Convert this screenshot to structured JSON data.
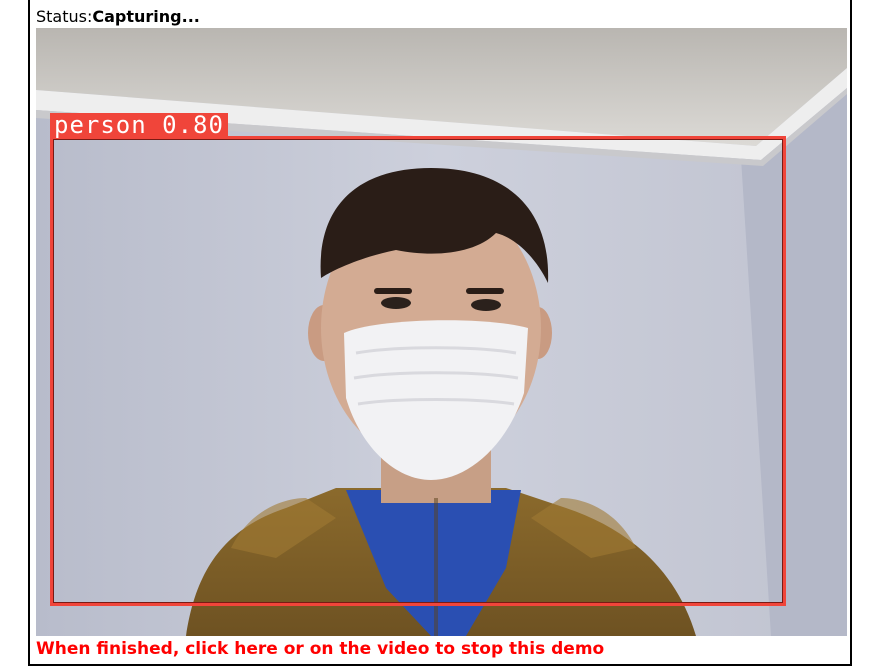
{
  "status": {
    "label": "Status:",
    "value": "Capturing..."
  },
  "detection": {
    "class": "person",
    "score": "0.80",
    "label": "person 0.80",
    "box_color": "#f0453a"
  },
  "stop_link": {
    "text": "When finished, click here or on the video to stop this demo",
    "color": "#ff0000"
  }
}
